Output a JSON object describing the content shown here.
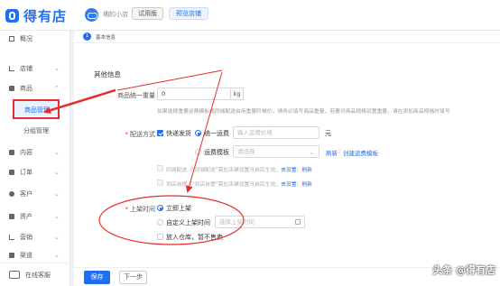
{
  "app": {
    "logo_text": "得有店",
    "shop_name": "缃的小店",
    "trial_badge": "试用版",
    "preview_button": "预览店铺",
    "brand_color": "#1f6ff0",
    "annotation_color": "#e62e2e"
  },
  "sidebar": {
    "items": [
      {
        "label": "概况",
        "icon": "overview-icon"
      },
      {
        "label": "店铺",
        "icon": "store-icon"
      },
      {
        "label": "商品",
        "icon": "goods-icon"
      },
      {
        "label": "内容",
        "icon": "content-icon"
      },
      {
        "label": "订单",
        "icon": "order-icon"
      },
      {
        "label": "客户",
        "icon": "customer-icon"
      },
      {
        "label": "资产",
        "icon": "asset-icon"
      },
      {
        "label": "营销",
        "icon": "marketing-icon"
      },
      {
        "label": "渠道",
        "icon": "channel-icon"
      }
    ],
    "sub_items": [
      {
        "label": "商品管理",
        "active": true
      },
      {
        "label": "分组管理",
        "active": false
      }
    ],
    "service_label": "在线客服"
  },
  "step": {
    "number": "1",
    "label": "基本信息"
  },
  "form": {
    "section_title": "其他信息",
    "weight": {
      "label": "商品统一重量",
      "value": "0",
      "unit": "kg",
      "hint": "如果选择重量运费模板或同城配送启用重量阶梯价，请务必填写商品重量，若要对商品规格设置重量，请在添加商品规格时填写"
    },
    "delivery": {
      "label": "配送方式",
      "express_label": "快递发货",
      "express_checked": true,
      "uniform_fee_label": "统一运费",
      "uniform_fee_placeholder": "输入运费价格",
      "currency_unit": "元",
      "template_label": "运费模板",
      "template_placeholder": "请选择",
      "refresh_link": "刷新",
      "create_template_link": "创建运费模板",
      "city_delivery_text": "同城配送（\"同城配送\"需在店铺设置开启后生效",
      "city_delivery_link": "去设置",
      "pickup_text": "到店自提（\"到店自提\"需在店铺设置开启后生效",
      "pickup_link": "去设置",
      "refresh_short": "刷新"
    },
    "listing": {
      "label": "上架时间",
      "immediate_label": "立即上架",
      "custom_label": "自定义上架时间",
      "custom_placeholder": "选择上架时间",
      "warehouse_label": "放入仓库，暂不售卖"
    }
  },
  "buttons": {
    "save": "保存",
    "next": "下一步"
  },
  "watermark": "头条 @得有店"
}
